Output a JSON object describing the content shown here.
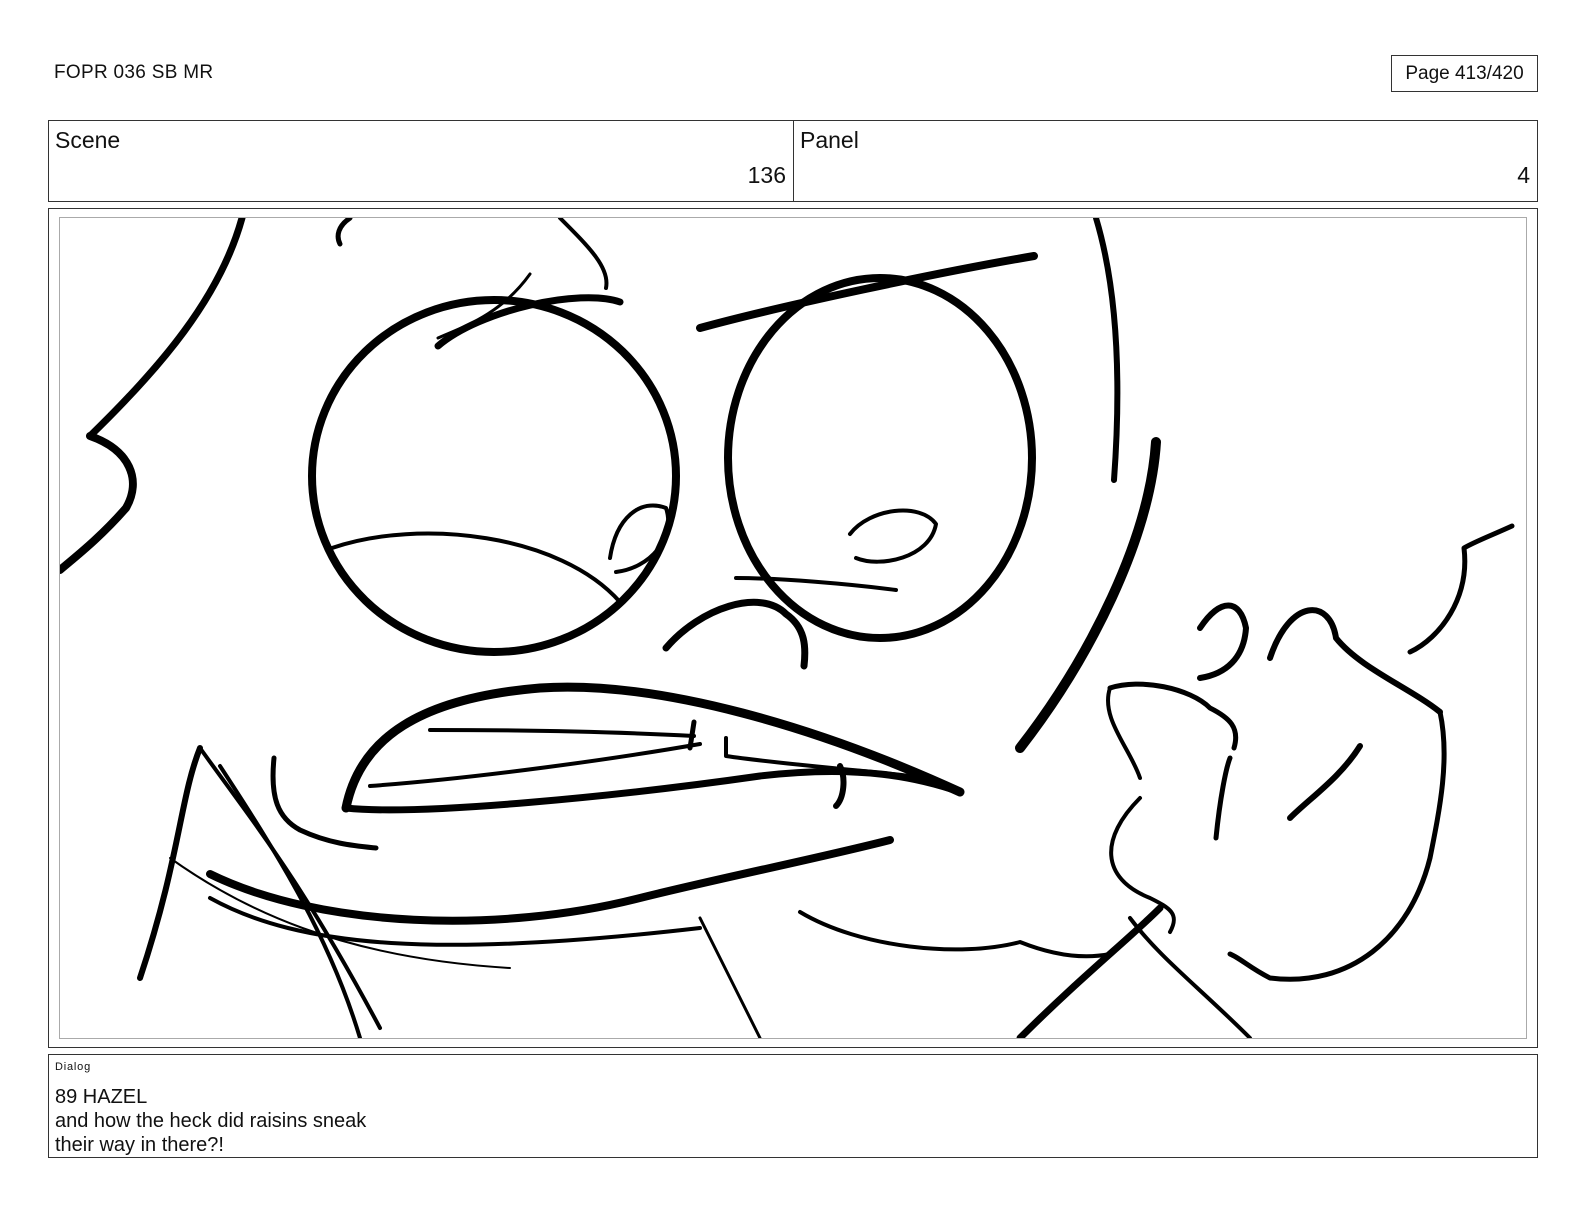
{
  "header": {
    "document_title": "FOPR 036 SB MR",
    "page_label": "Page 413/420"
  },
  "info": {
    "scene_label": "Scene",
    "scene_value": "136",
    "panel_label": "Panel",
    "panel_value": "4"
  },
  "dialog": {
    "label": "Dialog",
    "lines": [
      "89 HAZEL",
      "and how the heck did raisins sneak",
      "their way in there?!"
    ]
  }
}
